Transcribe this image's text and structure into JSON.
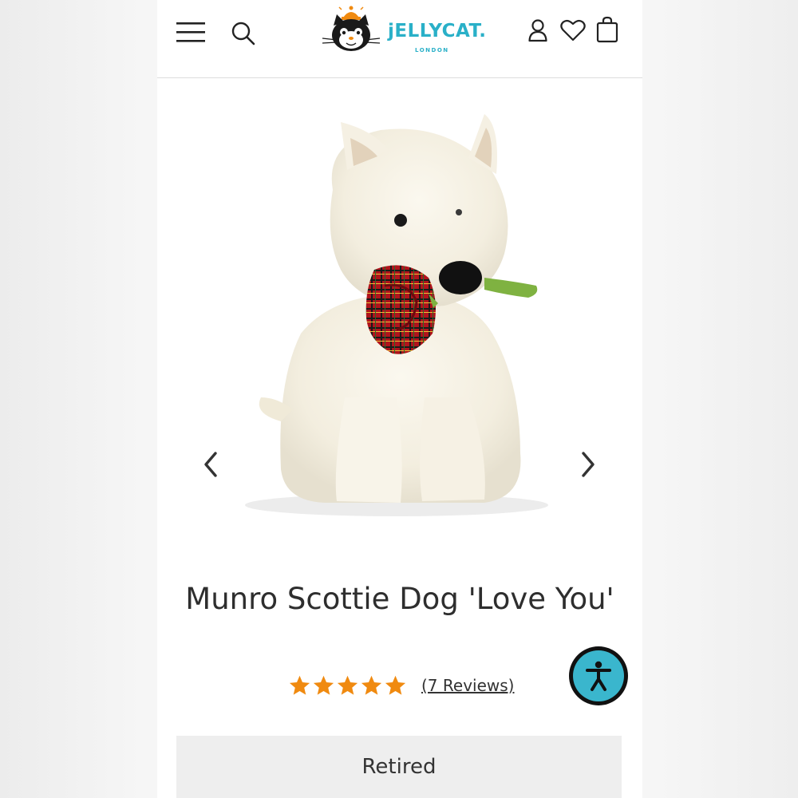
{
  "header": {
    "menu_icon": "hamburger-menu-icon",
    "search_icon": "search-icon",
    "logo_text": "jELLYCAT.",
    "logo_subtext": "LONDON",
    "account_icon": "user-icon",
    "wishlist_icon": "heart-icon",
    "bag_icon": "shopping-bag-icon"
  },
  "gallery": {
    "prev_icon": "chevron-left-icon",
    "next_icon": "chevron-right-icon"
  },
  "product": {
    "title": "Munro Scottie Dog 'Love You'",
    "rating": 5,
    "rating_max": 5,
    "reviews_label": "(7 Reviews)",
    "status": "Retired"
  },
  "colors": {
    "brand": "#2ab0c8",
    "star": "#f08a10",
    "accessibility": "#3ab6cd"
  },
  "accessibility": {
    "icon": "accessibility-person-icon"
  }
}
